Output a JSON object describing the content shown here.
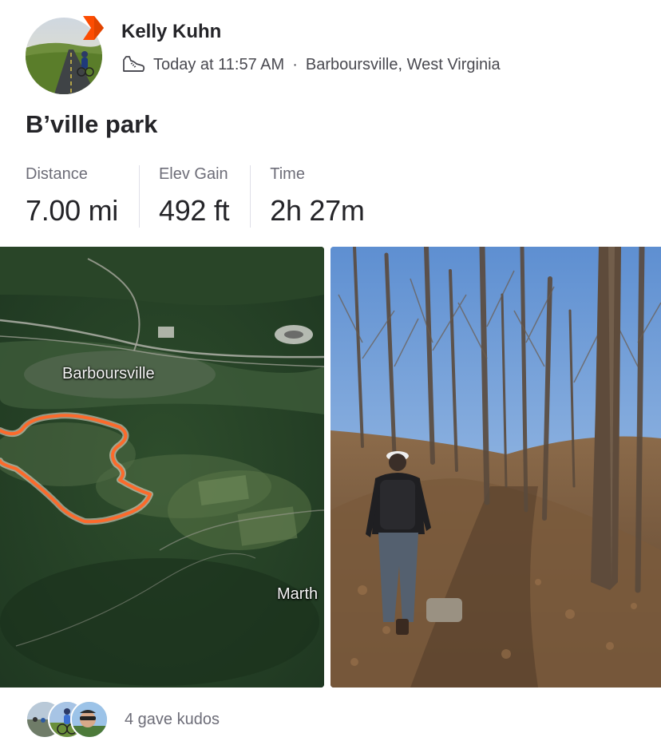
{
  "athlete": {
    "name": "Kelly Kuhn",
    "avatar_icon": "road-cyclist-avatar",
    "badge_icon": "subscriber-chevron-badge",
    "badge_color": "#fc4c02"
  },
  "activity": {
    "type_icon": "hiking-shoe-icon",
    "timestamp": "Today at 11:57 AM",
    "separator": "·",
    "location": "Barboursville, West Virginia",
    "title": "B’ville park"
  },
  "stats": [
    {
      "label": "Distance",
      "value": "7.00 mi"
    },
    {
      "label": "Elev Gain",
      "value": "492 ft"
    },
    {
      "label": "Time",
      "value": "2h 27m"
    }
  ],
  "media": {
    "map": {
      "route_color": "#fc6a2b",
      "labels": [
        "Barboursville",
        "Marth"
      ]
    },
    "photo": {
      "subject": "hiker-on-wooded-trail"
    }
  },
  "kudos": {
    "avatars": [
      "group-ride-avatar",
      "cyclist-avatar",
      "selfie-avatar"
    ],
    "text": "4 gave kudos"
  }
}
